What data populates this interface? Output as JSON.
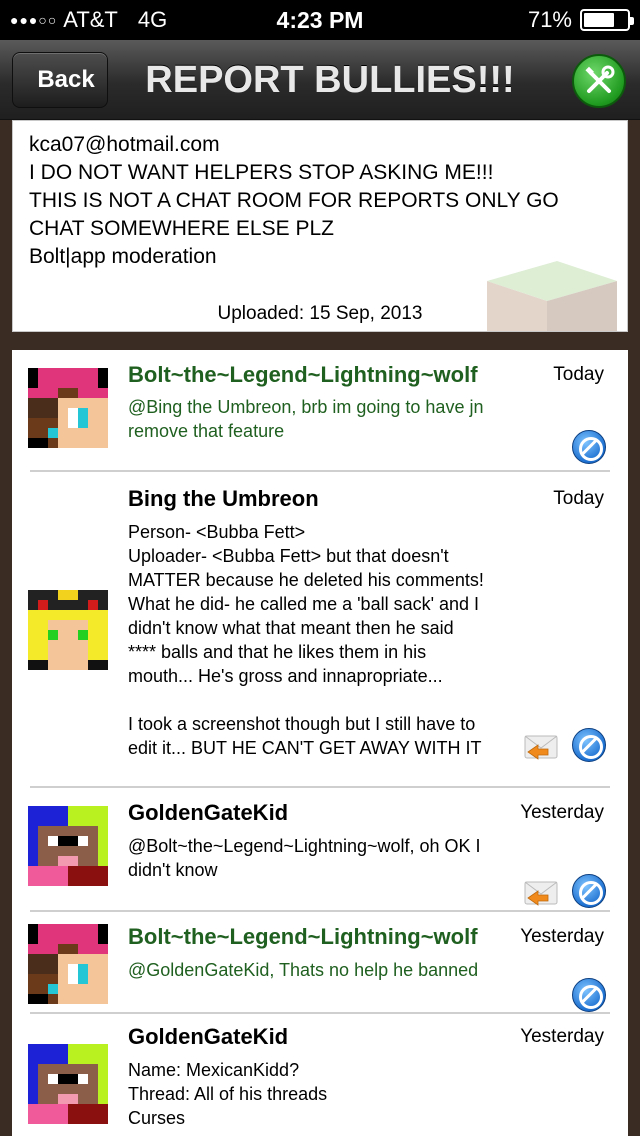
{
  "status_bar": {
    "signal": "●●●○○",
    "carrier": "AT&T",
    "network": "4G",
    "time": "4:23 PM",
    "battery_percent": "71%",
    "battery_level": 0.71
  },
  "nav": {
    "back_label": "Back",
    "title": "REPORT BULLIES!!!",
    "tools_icon": "tools-icon"
  },
  "header_card": {
    "description_lines": [
      "kca07@hotmail.com",
      "I DO NOT WANT HELPERS STOP ASKING ME!!!",
      "THIS IS NOT A CHAT ROOM FOR REPORTS ONLY GO",
      "CHAT SOMEWHERE ELSE PLZ",
      "Bolt|app moderation"
    ],
    "uploaded": "Uploaded: 15 Sep, 2013"
  },
  "comments": [
    {
      "author": "Bolt~the~Legend~Lightning~wolf",
      "when": "Today",
      "body": "@Bing the Umbreon, brb im going to have jn\nremove that feature",
      "moderator": true,
      "has_reply": false
    },
    {
      "author": "Bing the Umbreon",
      "when": "Today",
      "body": "Person- <Bubba Fett>\nUploader- <Bubba Fett> but that doesn't\nMATTER because he deleted his comments!\nWhat he did- he called me a 'ball sack' and I\ndidn't know what that meant then he said\n**** balls and that he likes them in his\nmouth... He's gross and innapropriate...\n\nI took a screenshot though but I still have to\nedit it... BUT HE CAN'T GET AWAY WITH IT",
      "moderator": false,
      "has_reply": true
    },
    {
      "author": "GoldenGateKid",
      "when": "Yesterday",
      "body": "@Bolt~the~Legend~Lightning~wolf, oh OK I\ndidn't know",
      "moderator": false,
      "has_reply": true
    },
    {
      "author": "Bolt~the~Legend~Lightning~wolf",
      "when": "Yesterday",
      "body": "@GoldenGateKid, Thats no help he banned",
      "moderator": true,
      "has_reply": false
    },
    {
      "author": "GoldenGateKid",
      "when": "Yesterday",
      "body": "Name: MexicanKidd?\nThread: All of his threads\nCurses",
      "moderator": false,
      "has_reply": true
    }
  ]
}
